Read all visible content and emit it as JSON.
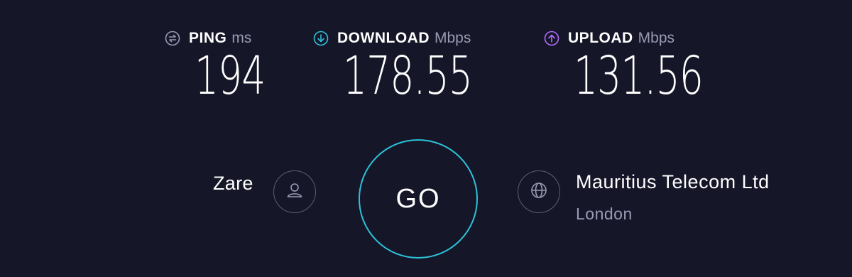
{
  "metrics": {
    "ping": {
      "name": "PING",
      "unit": "ms",
      "value": "194",
      "icon": "ping-icon",
      "color": "#9a9bb3"
    },
    "download": {
      "name": "DOWNLOAD",
      "unit": "Mbps",
      "value": "178.55",
      "icon": "download-arrow-icon",
      "color": "#2cc3d9"
    },
    "upload": {
      "name": "UPLOAD",
      "unit": "Mbps",
      "value": "131.56",
      "icon": "upload-arrow-icon",
      "color": "#b26dfa"
    }
  },
  "user": {
    "name": "Zare",
    "icon": "user-icon"
  },
  "go": {
    "label": "GO",
    "ring_color": "#2cc3d9"
  },
  "isp": {
    "name": "Mauritius Telecom Ltd",
    "location": "London",
    "icon": "globe-icon"
  },
  "theme": {
    "background": "#161629",
    "muted_text": "#9a9bb3"
  }
}
